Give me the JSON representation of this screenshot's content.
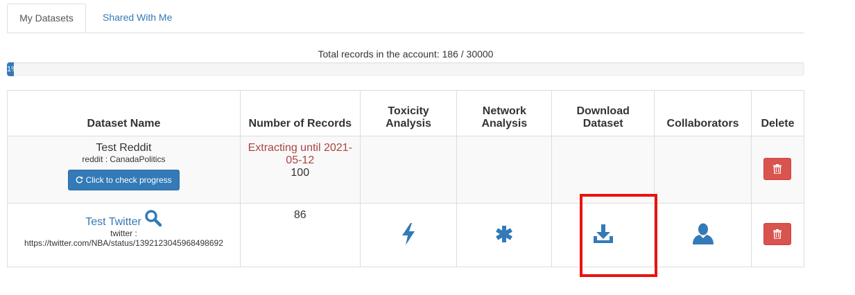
{
  "tabs": [
    {
      "label": "My Datasets"
    },
    {
      "label": "Shared With Me"
    }
  ],
  "summary": {
    "total_text": "Total records in the account: 186 / 30000",
    "progress_label": "1%",
    "progress_fraction": 0.0062
  },
  "table": {
    "headers": {
      "name": "Dataset Name",
      "records": "Number of Records",
      "toxicity_1": "Toxicity",
      "toxicity_2": "Analysis",
      "network_1": "Network",
      "network_2": "Analysis",
      "download_1": "Download",
      "download_2": "Dataset",
      "collaborators": "Collaborators",
      "delete": "Delete"
    },
    "rows": [
      {
        "name": "Test Reddit",
        "source": "reddit : CanadaPolitics",
        "button": "Click to check progress",
        "status_1": "Extracting until 2021-",
        "status_2": "05-12",
        "records": "100"
      },
      {
        "name": "Test Twitter",
        "source_1": "twitter :",
        "source_2": "https://twitter.com/NBA/status/1392123045968498692",
        "records": "86"
      }
    ]
  },
  "colors": {
    "primary": "#337ab7",
    "danger": "#d9534f",
    "extracting": "#a94442",
    "highlight": "#e8130f"
  },
  "icons": [
    "refresh-icon",
    "search-icon",
    "bolt-icon",
    "asterisk-icon",
    "download-icon",
    "user-icon",
    "trash-icon"
  ]
}
